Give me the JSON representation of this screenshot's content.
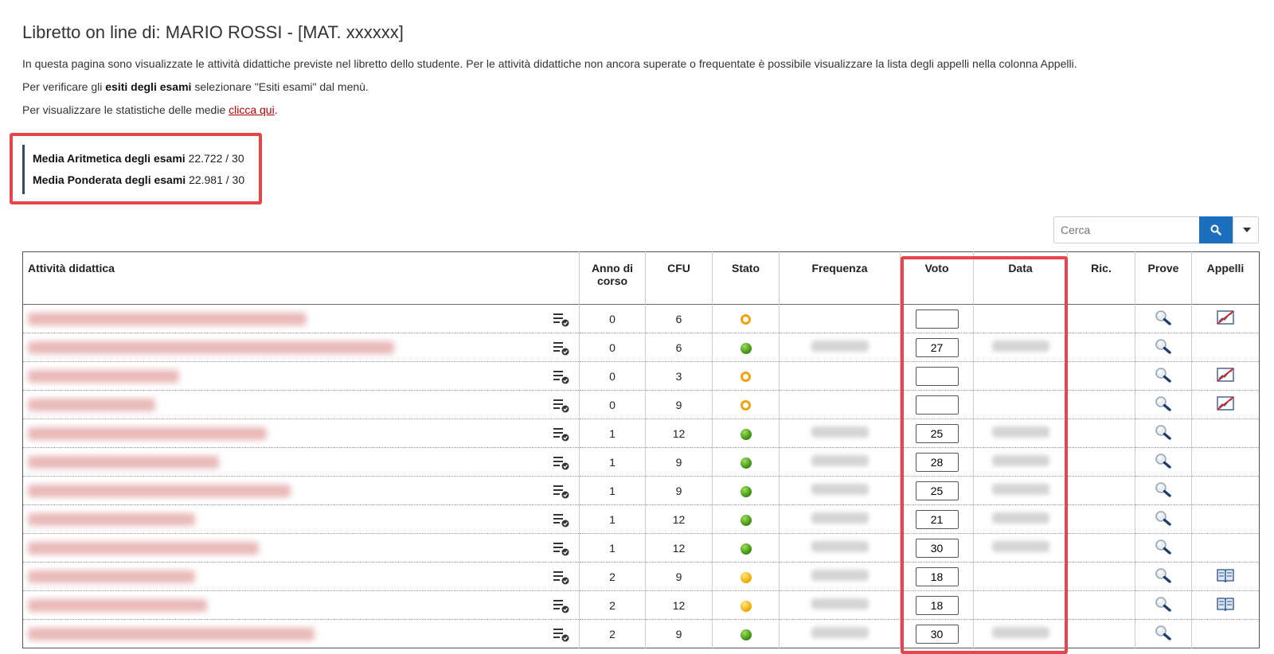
{
  "page": {
    "title": "Libretto on line di: MARIO ROSSI - [MAT. xxxxxx]",
    "intro": "In questa pagina sono visualizzate le attività didattiche previste nel libretto dello studente. Per le attività didattiche non ancora superate o frequentate è possibile visualizzare la lista degli appelli nella colonna Appelli.",
    "esiti_pre": "Per verificare gli ",
    "esiti_bold": "esiti degli esami",
    "esiti_post": " selezionare \"Esiti esami\" dal menù.",
    "stats_pre": "Per visualizzare le statistiche delle medie ",
    "stats_link": "clicca qui",
    "stats_post": "."
  },
  "averages": {
    "arith_label": "Media Aritmetica degli esami",
    "arith_value": "22.722 / 30",
    "weighted_label": "Media Ponderata degli esami",
    "weighted_value": "22.981 / 30"
  },
  "search": {
    "placeholder": "Cerca"
  },
  "table": {
    "headers": {
      "activity": "Attività didattica",
      "year": "Anno di corso",
      "cfu": "CFU",
      "status": "Stato",
      "frequency": "Frequenza",
      "grade": "Voto",
      "date": "Data",
      "ric": "Ric.",
      "tests": "Prove",
      "appeals": "Appelli"
    },
    "rows": [
      {
        "year": "0",
        "cfu": "6",
        "status": "planned",
        "grade": "",
        "appeals": "chart"
      },
      {
        "year": "0",
        "cfu": "6",
        "status": "passed",
        "grade": "27",
        "appeals": ""
      },
      {
        "year": "0",
        "cfu": "3",
        "status": "planned",
        "grade": "",
        "appeals": "chart"
      },
      {
        "year": "0",
        "cfu": "9",
        "status": "planned",
        "grade": "",
        "appeals": "chart"
      },
      {
        "year": "1",
        "cfu": "12",
        "status": "passed",
        "grade": "25",
        "appeals": ""
      },
      {
        "year": "1",
        "cfu": "9",
        "status": "passed",
        "grade": "28",
        "appeals": ""
      },
      {
        "year": "1",
        "cfu": "9",
        "status": "passed",
        "grade": "25",
        "appeals": ""
      },
      {
        "year": "1",
        "cfu": "12",
        "status": "passed",
        "grade": "21",
        "appeals": ""
      },
      {
        "year": "1",
        "cfu": "12",
        "status": "passed",
        "grade": "30",
        "appeals": ""
      },
      {
        "year": "2",
        "cfu": "9",
        "status": "frequented",
        "grade": "18",
        "appeals": "book"
      },
      {
        "year": "2",
        "cfu": "12",
        "status": "frequented",
        "grade": "18",
        "appeals": "book"
      },
      {
        "year": "2",
        "cfu": "9",
        "status": "passed",
        "grade": "30",
        "appeals": ""
      }
    ]
  },
  "colors": {
    "accent_blue": "#1b6fbd",
    "highlight_red": "#e8444a",
    "link_red": "#b30000"
  }
}
